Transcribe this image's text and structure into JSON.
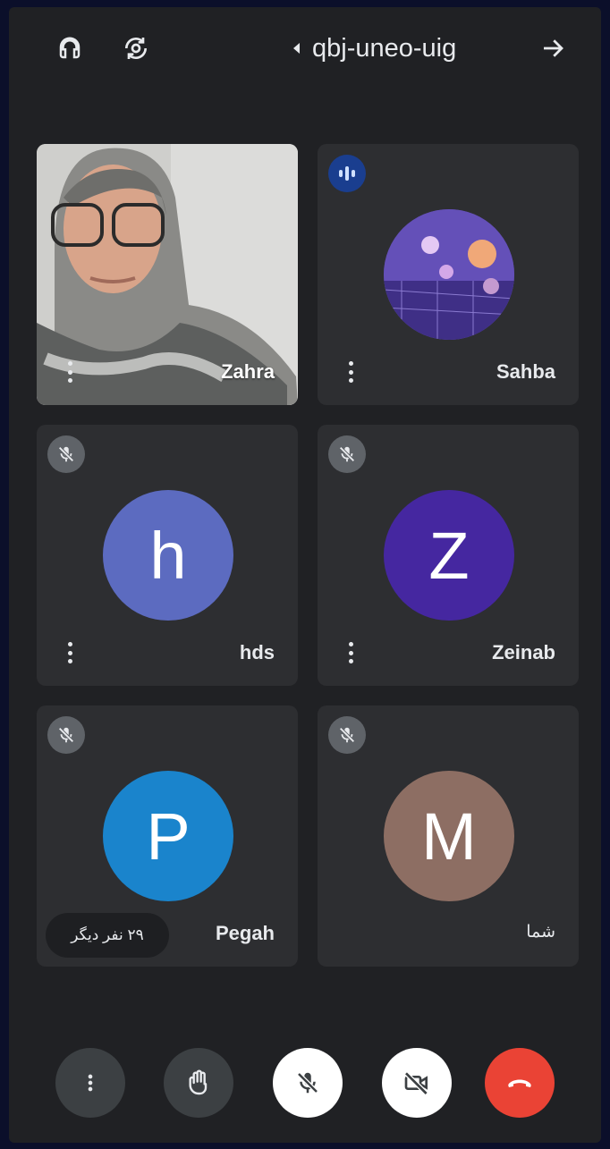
{
  "meeting": {
    "code": "qbj-uneo-uig"
  },
  "icons": {
    "audio": "headphones-icon",
    "switch_camera": "switch-camera-icon",
    "share_arrow": "arrow-forward-icon",
    "more": "more-vert-icon",
    "raise_hand": "hand-icon",
    "mic_off": "mic-off-icon",
    "camera_off": "videocam-off-icon",
    "end_call": "call-end-icon"
  },
  "participants": [
    {
      "name": "Zahra",
      "muted": false,
      "video": true
    },
    {
      "name": "Sahba",
      "muted": false,
      "speaking": true,
      "avatar": "photo"
    },
    {
      "name": "hds",
      "muted": true,
      "initial": "h",
      "color": "#5c6bc0"
    },
    {
      "name": "Zeinab",
      "muted": true,
      "initial": "Z",
      "color": "#4527a0"
    },
    {
      "name": "Pegah",
      "muted": true,
      "initial": "P",
      "color": "#1a84cc"
    },
    {
      "name": "شما",
      "muted": true,
      "initial": "M",
      "color": "#8d6e63"
    }
  ],
  "others_label": "۲۹ نفر دیگر",
  "colors": {
    "background": "#202124",
    "tile": "#2d2e31",
    "end_call": "#ea4335",
    "speaking": "#1a3e8f"
  }
}
